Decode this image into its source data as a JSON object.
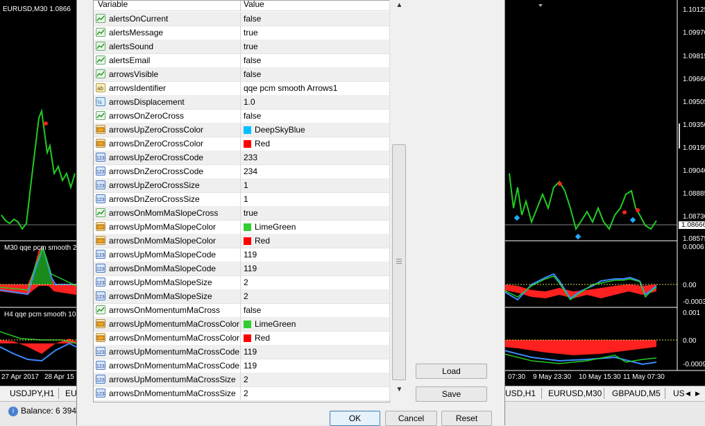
{
  "left_chart": {
    "title": "EURUSD,M30  1.0866",
    "ind1_label": "M30  qqe pcm smooth  2",
    "ind2_label": "H4  qqe pcm smooth  10",
    "dates": [
      "27 Apr 2017",
      "28 Apr 15"
    ]
  },
  "right_chart": {
    "price_axis": [
      "1.10125",
      "1.09970",
      "1.09815",
      "1.09660",
      "1.09505",
      "1.09350",
      "1.09195",
      "1.09040",
      "1.08885",
      "1.08730",
      "1.08666",
      "1.08575"
    ],
    "ind1_axis": [
      "0.0006",
      "0.00",
      "-0.0003"
    ],
    "ind2_axis": [
      "0.001",
      "0.00",
      "-0.0009"
    ],
    "dates": [
      "07:30",
      "9 May 23:30",
      "10 May 15:30",
      "11 May 07:30"
    ]
  },
  "tabs": [
    "USDJPY,H1",
    "EU",
    "USD,H1",
    "EURUSD,M30",
    "GBPAUD,M5",
    "US"
  ],
  "status": {
    "balance": "Balance: 6 394."
  },
  "grid": {
    "headers": {
      "variable": "Variable",
      "value": "Value"
    },
    "rows": [
      {
        "icon": "bool",
        "name": "alertsOnCurrent",
        "value": "false"
      },
      {
        "icon": "bool",
        "name": "alertsMessage",
        "value": "true"
      },
      {
        "icon": "bool",
        "name": "alertsSound",
        "value": "true"
      },
      {
        "icon": "bool",
        "name": "alertsEmail",
        "value": "false"
      },
      {
        "icon": "bool",
        "name": "arrowsVisible",
        "value": "false"
      },
      {
        "icon": "string",
        "name": "arrowsIdentifier",
        "value": "qqe pcm smooth Arrows1"
      },
      {
        "icon": "double",
        "name": "arrowsDisplacement",
        "value": "1.0"
      },
      {
        "icon": "bool",
        "name": "arrowsOnZeroCross",
        "value": "false"
      },
      {
        "icon": "color",
        "name": "arrowsUpZeroCrossColor",
        "value": "DeepSkyBlue",
        "swatch": "#00BFFF"
      },
      {
        "icon": "color",
        "name": "arrowsDnZeroCrossColor",
        "value": "Red",
        "swatch": "#FF0000"
      },
      {
        "icon": "int",
        "name": "arrowsUpZeroCrossCode",
        "value": "233"
      },
      {
        "icon": "int",
        "name": "arrowsDnZeroCrossCode",
        "value": "234"
      },
      {
        "icon": "int",
        "name": "arrowsUpZeroCrossSize",
        "value": "1"
      },
      {
        "icon": "int",
        "name": "arrowsDnZeroCrossSize",
        "value": "1"
      },
      {
        "icon": "bool",
        "name": "arrowsOnMomMaSlopeCross",
        "value": "true"
      },
      {
        "icon": "color",
        "name": "arrowsUpMomMaSlopeColor",
        "value": "LimeGreen",
        "swatch": "#32CD32"
      },
      {
        "icon": "color",
        "name": "arrowsDnMomMaSlopeColor",
        "value": "Red",
        "swatch": "#FF0000"
      },
      {
        "icon": "int",
        "name": "arrowsUpMomMaSlopeCode",
        "value": "119"
      },
      {
        "icon": "int",
        "name": "arrowsDnMomMaSlopeCode",
        "value": "119"
      },
      {
        "icon": "int",
        "name": "arrowsUpMomMaSlopeSize",
        "value": "2"
      },
      {
        "icon": "int",
        "name": "arrowsDnMomMaSlopeSize",
        "value": "2"
      },
      {
        "icon": "bool",
        "name": "arrowsOnMomentumMaCross",
        "value": "false"
      },
      {
        "icon": "color",
        "name": "arrowsUpMomentumMaCrossColor",
        "value": "LimeGreen",
        "swatch": "#32CD32"
      },
      {
        "icon": "color",
        "name": "arrowsDnMomentumMaCrossColor",
        "value": "Red",
        "swatch": "#FF0000"
      },
      {
        "icon": "int",
        "name": "arrowsUpMomentumMaCrossCode",
        "value": "119"
      },
      {
        "icon": "int",
        "name": "arrowsDnMomentumMaCrossCode",
        "value": "119"
      },
      {
        "icon": "int",
        "name": "arrowsUpMomentumMaCrossSize",
        "value": "2"
      },
      {
        "icon": "int",
        "name": "arrowsDnMomentumMaCrossSize",
        "value": "2"
      }
    ]
  },
  "buttons": {
    "load": "Load",
    "save": "Save",
    "ok": "OK",
    "cancel": "Cancel",
    "reset": "Reset"
  }
}
